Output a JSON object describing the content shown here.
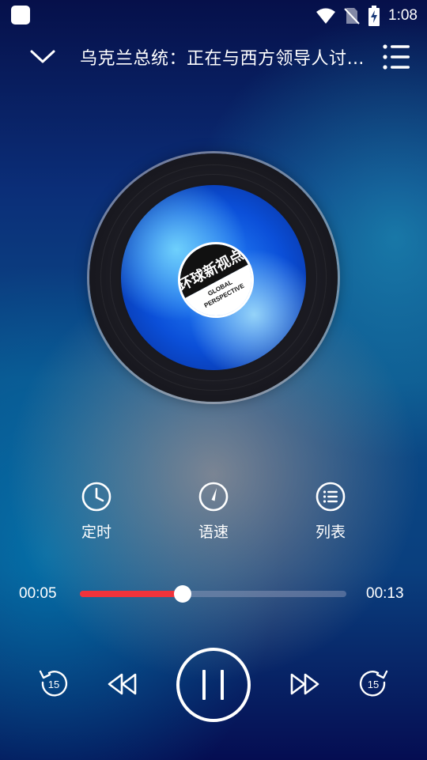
{
  "status_bar": {
    "time": "1:08",
    "icons": [
      "app-icon",
      "wifi-icon",
      "no-sim-icon",
      "battery-charging-icon"
    ]
  },
  "header": {
    "title": "乌克兰总统：正在与西方领导人讨论援助事宜",
    "collapse_icon": "chevron-down-icon",
    "playlist_icon": "playlist-icon"
  },
  "album_art": {
    "badge_cn": "环球新视点",
    "badge_en_line1": "GLOBAL",
    "badge_en_line2": "PERSPECTIVE"
  },
  "tools": [
    {
      "label": "定时",
      "icon": "clock-icon"
    },
    {
      "label": "语速",
      "icon": "speed-icon"
    },
    {
      "label": "列表",
      "icon": "list-icon"
    }
  ],
  "progress": {
    "current": "00:05",
    "total": "00:13",
    "fraction": 0.385
  },
  "controls": {
    "rewind_seconds": "15",
    "forward_seconds": "15",
    "state": "playing"
  },
  "colors": {
    "accent": "#f0333b",
    "foreground": "#ffffff"
  }
}
